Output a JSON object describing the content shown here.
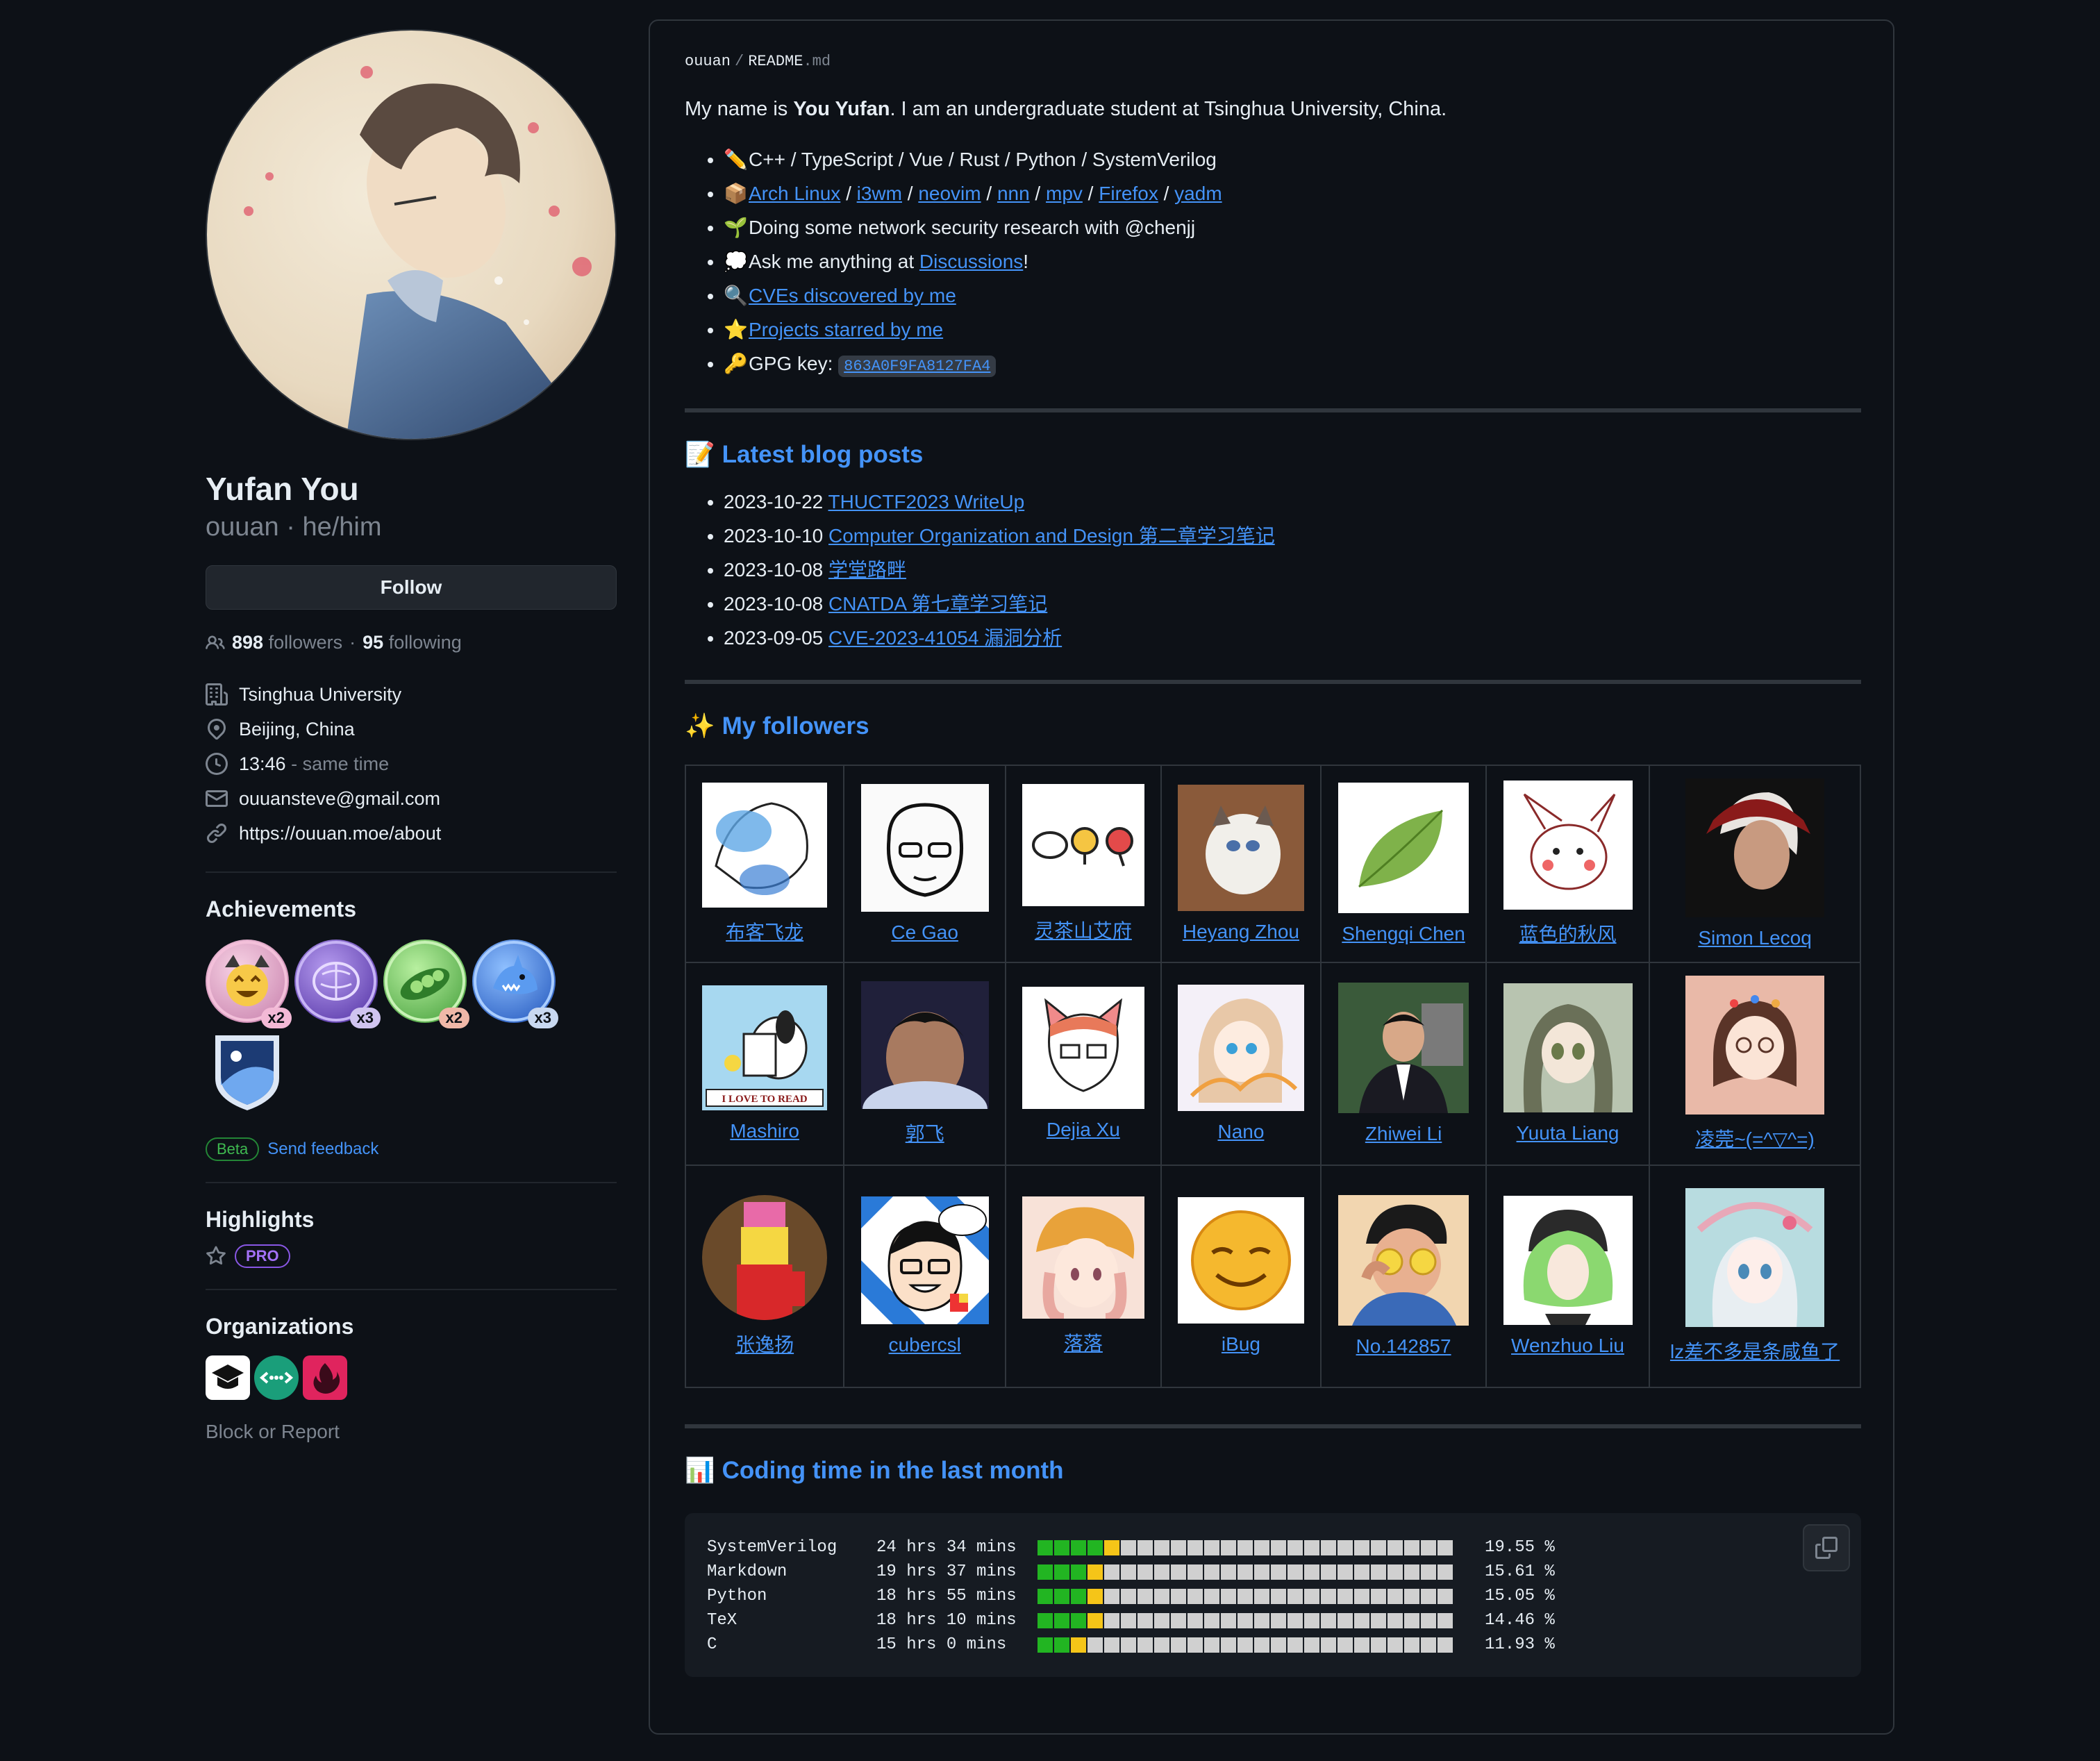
{
  "profile": {
    "name": "Yufan You",
    "handle": "ouuan",
    "pronouns": "he/him",
    "follow_label": "Follow",
    "followers_count": "898",
    "followers_label": "followers",
    "following_count": "95",
    "following_label": "following",
    "organization": "Tsinghua University",
    "location": "Beijing, China",
    "time": "13:46",
    "time_note": "- same time",
    "email": "ouuansteve@gmail.com",
    "website": "https://ouuan.moe/about"
  },
  "achievements": {
    "heading": "Achievements",
    "badges": [
      {
        "name": "starstruck-badge",
        "count": "x2",
        "color": "#e8a4c4"
      },
      {
        "name": "galaxy-brain-badge",
        "count": "x3",
        "color": "#8e6cd6"
      },
      {
        "name": "pair-extraordinaire-badge",
        "count": "x2",
        "color": "#7ed66d"
      },
      {
        "name": "pull-shark-badge",
        "count": "x3",
        "color": "#4a8cf0"
      },
      {
        "name": "arctic-code-vault-badge"
      }
    ],
    "beta_label": "Beta",
    "feedback_label": "Send feedback"
  },
  "highlights": {
    "heading": "Highlights",
    "pro_label": "PRO"
  },
  "organizations": {
    "heading": "Organizations"
  },
  "block_report": "Block or Report",
  "readme": {
    "crumb_user": "ouuan",
    "crumb_file": "README",
    "crumb_ext": ".md",
    "intro_pre": "My name is ",
    "intro_name": "You Yufan",
    "intro_post": ". I am an undergraduate student at Tsinghua University, China.",
    "items": {
      "langs": "C++ / TypeScript / Vue / Rust / Python / SystemVerilog",
      "tools": [
        "Arch Linux",
        "i3wm",
        "neovim",
        "nnn",
        "mpv",
        "Firefox",
        "yadm"
      ],
      "research": "Doing some network security research with @chenjj",
      "ask_pre": "Ask me anything at ",
      "ask_link": "Discussions",
      "ask_post": "!",
      "cves": "CVEs discovered by me",
      "stars": "Projects starred by me",
      "gpg_label": "GPG key:",
      "gpg_key": "863A0F9FA8127FA4"
    },
    "blog_heading": "Latest blog posts",
    "blog": [
      {
        "date": "2023-10-22",
        "title": "THUCTF2023 WriteUp"
      },
      {
        "date": "2023-10-10",
        "title": "Computer Organization and Design 第二章学习笔记"
      },
      {
        "date": "2023-10-08",
        "title": "学堂路畔"
      },
      {
        "date": "2023-10-08",
        "title": "CNATDA 第七章学习笔记"
      },
      {
        "date": "2023-09-05",
        "title": "CVE-2023-41054 漏洞分析"
      }
    ],
    "followers_heading": "My followers",
    "followers": [
      [
        "布客飞龙",
        "Ce Gao",
        "灵茶山艾府",
        "Heyang Zhou",
        "Shengqi Chen",
        "蓝色的秋风",
        "Simon Lecoq"
      ],
      [
        "Mashiro",
        "郭飞",
        "Dejia Xu",
        "Nano",
        "Zhiwei Li",
        "Yuuta Liang",
        "凌莞~(=^▽^=)"
      ],
      [
        "张逸扬",
        "cubercsl",
        "落落",
        "iBug",
        "No.142857",
        "Wenzhuo Liu",
        "lz差不多是条咸鱼了"
      ]
    ],
    "snoopy_caption": "I LOVE TO READ",
    "coding_heading": "Coding time in the last month",
    "coding": [
      {
        "lang": "SystemVerilog",
        "time": "24 hrs 34 mins",
        "percent": "19.55 %",
        "fraction": 0.1955
      },
      {
        "lang": "Markdown",
        "time": "19 hrs 37 mins",
        "percent": "15.61 %",
        "fraction": 0.1561
      },
      {
        "lang": "Python",
        "time": "18 hrs 55 mins",
        "percent": "15.05 %",
        "fraction": 0.1505
      },
      {
        "lang": "TeX",
        "time": "18 hrs 10 mins",
        "percent": "14.46 %",
        "fraction": 0.1446
      },
      {
        "lang": "C",
        "time": "15 hrs 0 mins",
        "percent": "11.93 %",
        "fraction": 0.1193
      }
    ]
  },
  "colors": {
    "link": "#4493f8",
    "bg": "#0d1117",
    "border": "#30363d",
    "bar_green": "#22b522",
    "bar_yellow": "#f5c518",
    "bar_empty": "#d0d0d0"
  }
}
